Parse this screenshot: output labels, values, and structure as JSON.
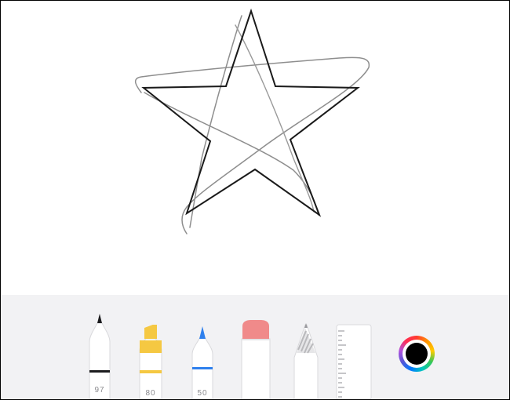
{
  "canvas": {
    "ink_color": "#1a1a1a",
    "pencil_color": "#8e8e8e"
  },
  "tools": {
    "pen": {
      "label": "97",
      "tip_color": "#1c1c1e"
    },
    "marker": {
      "label": "80",
      "tip_color": "#f5c842"
    },
    "crayon_pen": {
      "label": "50",
      "tip_color": "#2f80ed"
    },
    "eraser": {
      "tip_color": "#f08a8a"
    },
    "pencil": {
      "tip_color": "#b9b9bc"
    },
    "ruler": {}
  },
  "color_picker": {
    "selected_color": "#000000"
  }
}
